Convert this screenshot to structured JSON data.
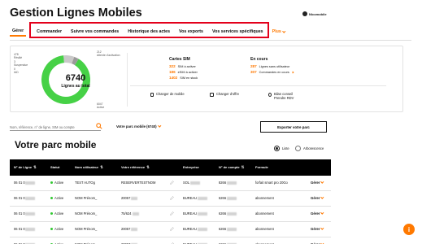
{
  "header": {
    "title": "Gestion Lignes Mobiles",
    "user_label": "Nicomobile"
  },
  "nav": {
    "tabs": [
      {
        "label": "Gérer",
        "active": true
      },
      {
        "label": "Commander"
      },
      {
        "label": "Suivre vos commandes"
      },
      {
        "label": "Historique des actes"
      },
      {
        "label": "Vos exports"
      },
      {
        "label": "Vos services spécifiques"
      },
      {
        "label": "Plus"
      }
    ]
  },
  "summary": {
    "total": "6740",
    "total_label": "Lignes au total",
    "chart_data": {
      "type": "pie",
      "categories": [
        "Active",
        "Résilié",
        "Suspendue",
        "IAD",
        "Attente d'activation"
      ],
      "values": [
        6047,
        478,
        3,
        0,
        212
      ],
      "colors": [
        "#46d146",
        "#c9c9c9",
        "#ff7900",
        "#222222",
        "#9a9a9a"
      ]
    },
    "segment_labels": [
      {
        "count": "478",
        "name": "Résilié"
      },
      {
        "count": "3",
        "name": "Suspendue"
      },
      {
        "count": "0",
        "name": "IAD"
      },
      {
        "count": "212",
        "name": "Attente d'activation"
      },
      {
        "count": "6047",
        "name": "Active"
      }
    ],
    "sim": {
      "title": "Cartes SIM",
      "rows": [
        {
          "value": "322",
          "label": "SIM à activer"
        },
        {
          "value": "186",
          "label": "eSIM à activer"
        },
        {
          "value": "1402",
          "label": "SIM en stock"
        }
      ]
    },
    "en_cours": {
      "title": "En cours",
      "rows": [
        {
          "value": "287",
          "label": "Lignes sans utilisateur"
        },
        {
          "value": "307",
          "label": "Commandes en cours"
        }
      ]
    },
    "actions": [
      {
        "label": "Changer de mobile"
      },
      {
        "label": "Changer d'offre"
      },
      {
        "label": "Bilan conseil",
        "label2": "Prendre RDV"
      }
    ]
  },
  "search": {
    "placeholder": "Nom, référence, n° de ligne, SIM ou compte",
    "parc_select": "Votre parc mobile (6740)",
    "export_label": "Exporter votre parc"
  },
  "parc": {
    "title": "Votre parc mobile",
    "view_options": [
      "Liste",
      "Arborescence"
    ],
    "selected_view": "Liste",
    "columns": [
      "N° de Ligne",
      "Statut",
      "Nom utilisateur",
      "Votre référence",
      "Entreprise",
      "N° de compte",
      "Formule"
    ],
    "rows": [
      {
        "line": "06 01 0",
        "status": "Active",
        "user": "TEST AUTOg",
        "reference": "RESERVERTESTNOM",
        "company": "SOL",
        "account": "8266",
        "formula": "forfait smart pro 20Go",
        "action": "Gérer"
      },
      {
        "line": "06 01 0",
        "status": "Active",
        "user": "NOM Prénom_",
        "reference": "20057",
        "company": "BUREAU",
        "account": "6266",
        "formula": "abonnement",
        "action": "Gérer"
      },
      {
        "line": "06 01 0",
        "status": "Active",
        "user": "NOM Prénom_",
        "reference": "75/624",
        "company": "BUREAU",
        "account": "6266",
        "formula": "abonnement",
        "action": "Gérer"
      },
      {
        "line": "06 01 0",
        "status": "Active",
        "user": "NOM Prénom_",
        "reference": "20057",
        "company": "BUREAU",
        "account": "6266",
        "formula": "abonnement",
        "action": "Gérer"
      },
      {
        "line": "06 01 0",
        "status": "Active",
        "user": "NOM Prénom_",
        "reference": "20057",
        "company": "BUREAU",
        "account": "6266",
        "formula": "abonnement",
        "action": "Gérer"
      }
    ]
  },
  "help": {
    "label": "i"
  }
}
